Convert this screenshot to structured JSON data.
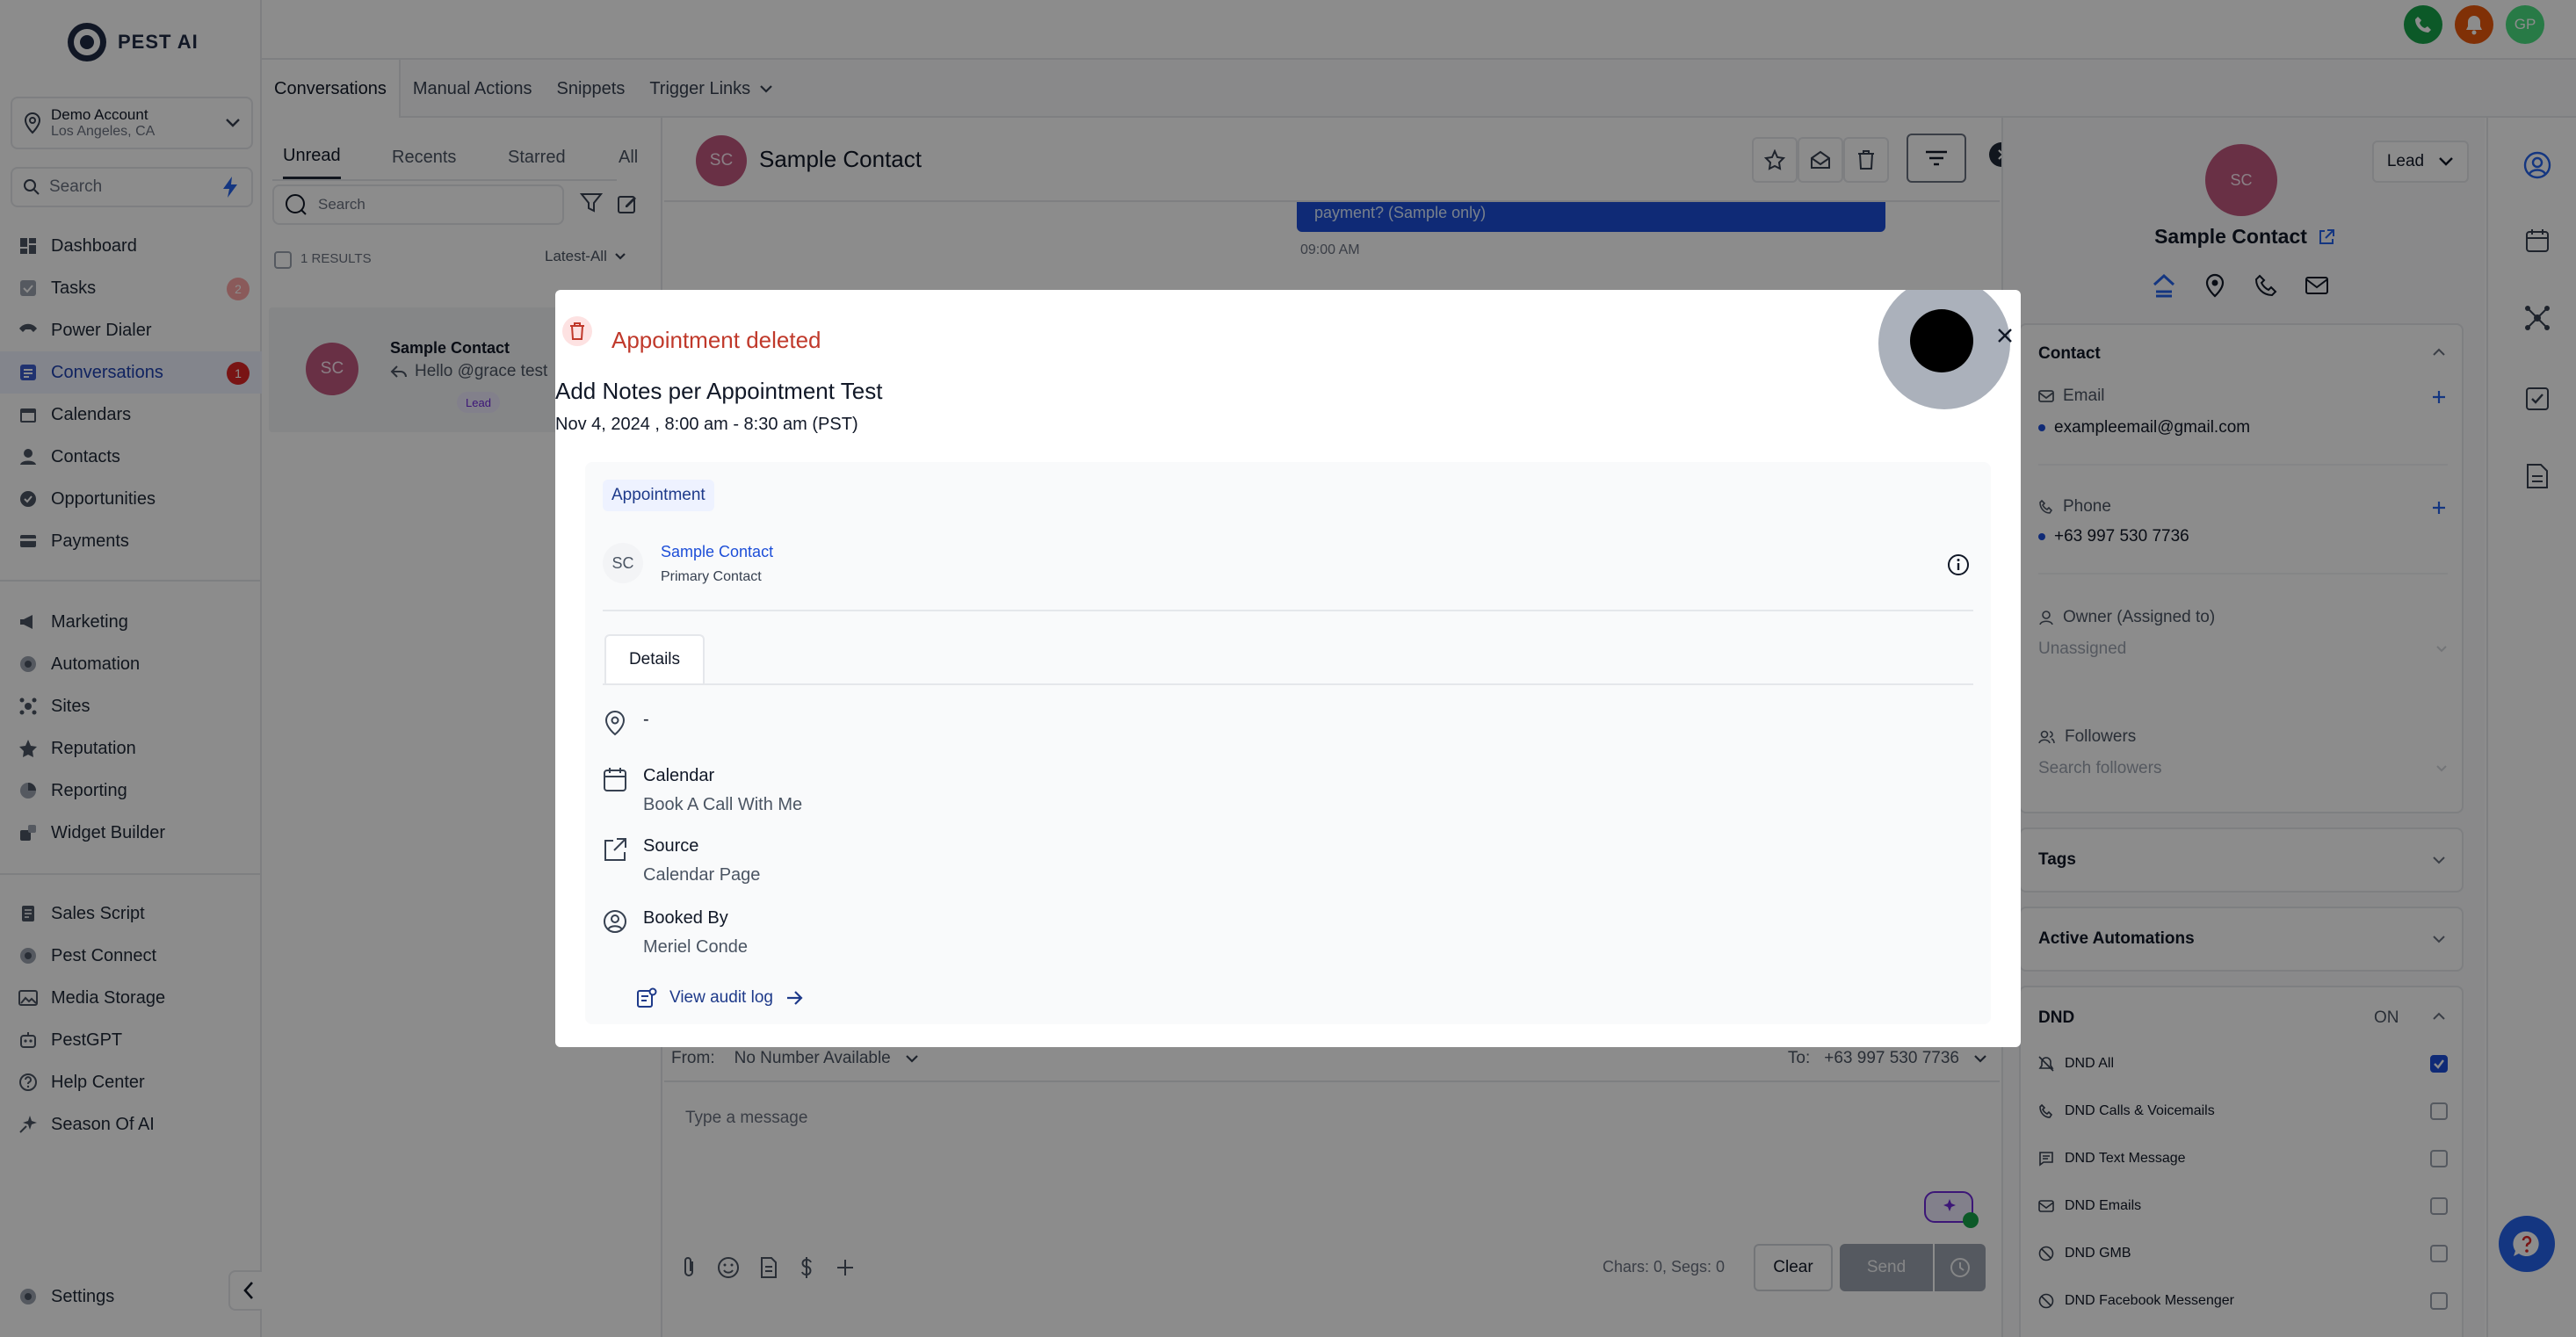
{
  "app": {
    "brand": "PEST AI"
  },
  "account": {
    "name": "Demo Account",
    "location": "Los Angeles, CA"
  },
  "sidebar": {
    "search_placeholder": "Search",
    "group1": [
      {
        "label": "Dashboard",
        "icon": "dashboard-icon"
      },
      {
        "label": "Tasks",
        "icon": "tasks-icon",
        "badge": "2"
      },
      {
        "label": "Power Dialer",
        "icon": "power-dialer-icon"
      },
      {
        "label": "Conversations",
        "icon": "conversations-icon",
        "badge": "1",
        "active": true
      },
      {
        "label": "Calendars",
        "icon": "calendar-icon"
      },
      {
        "label": "Contacts",
        "icon": "contacts-icon"
      },
      {
        "label": "Opportunities",
        "icon": "opportunities-icon"
      },
      {
        "label": "Payments",
        "icon": "payments-icon"
      }
    ],
    "group2": [
      {
        "label": "Marketing",
        "icon": "marketing-icon"
      },
      {
        "label": "Automation",
        "icon": "automation-icon"
      },
      {
        "label": "Sites",
        "icon": "sites-icon"
      },
      {
        "label": "Reputation",
        "icon": "reputation-icon"
      },
      {
        "label": "Reporting",
        "icon": "reporting-icon"
      },
      {
        "label": "Widget Builder",
        "icon": "widget-builder-icon"
      }
    ],
    "group3": [
      {
        "label": "Sales Script",
        "icon": "sales-script-icon"
      },
      {
        "label": "Pest Connect",
        "icon": "pest-connect-icon"
      },
      {
        "label": "Media Storage",
        "icon": "media-storage-icon"
      },
      {
        "label": "PestGPT",
        "icon": "pestgpt-icon"
      },
      {
        "label": "Help Center",
        "icon": "help-center-icon"
      },
      {
        "label": "Season Of AI",
        "icon": "season-of-ai-icon"
      }
    ],
    "settings_label": "Settings"
  },
  "topbar": {
    "user_initials": "GP",
    "colors": {
      "phone": "#16a34a",
      "bell": "#ea580c",
      "user": "#4ade80"
    }
  },
  "tabs": [
    "Conversations",
    "Manual Actions",
    "Snippets",
    "Trigger Links"
  ],
  "conv_list": {
    "subtabs": [
      "Unread",
      "Recents",
      "Starred",
      "All"
    ],
    "search_placeholder": "Search",
    "results_label": "1 RESULTS",
    "sort_label": "Latest-All",
    "item": {
      "initials": "SC",
      "name": "Sample Contact",
      "preview": "Hello @grace test",
      "tag": "Lead"
    }
  },
  "chat": {
    "contact_initials": "SC",
    "contact_name": "Sample Contact",
    "bubble_text": "payment? (Sample only)",
    "bubble_time": "09:00 AM",
    "from_label": "From:",
    "from_value": "No Number Available",
    "to_label": "To:",
    "to_value": "+63 997 530 7736",
    "message_placeholder": "Type a message",
    "chars_label": "Chars: 0, Segs: 0",
    "clear_label": "Clear",
    "send_label": "Send"
  },
  "right_panel": {
    "stage": "Lead",
    "initials": "SC",
    "name": "Sample Contact",
    "contact_section": "Contact",
    "email_label": "Email",
    "email_value": "exampleemail@gmail.com",
    "phone_label": "Phone",
    "phone_value": "+63 997 530 7736",
    "owner_label": "Owner (Assigned to)",
    "owner_value": "Unassigned",
    "followers_label": "Followers",
    "followers_placeholder": "Search followers",
    "tags_label": "Tags",
    "automations_label": "Active Automations",
    "dnd_label": "DND",
    "dnd_state": "ON",
    "dnd_items": [
      {
        "label": "DND All",
        "checked": true,
        "icon": "bell-off-icon"
      },
      {
        "label": "DND Calls & Voicemails",
        "checked": false,
        "icon": "phone-icon"
      },
      {
        "label": "DND Text Message",
        "checked": false,
        "icon": "message-icon"
      },
      {
        "label": "DND Emails",
        "checked": false,
        "icon": "mail-icon"
      },
      {
        "label": "DND GMB",
        "checked": false,
        "icon": "block-icon"
      },
      {
        "label": "DND Facebook Messenger",
        "checked": false,
        "icon": "block-icon"
      }
    ]
  },
  "modal": {
    "status": "Appointment deleted",
    "title": "Add Notes per Appointment Test",
    "datetime": "Nov 4, 2024 , 8:00 am - 8:30 am (PST)",
    "appointment_tag": "Appointment",
    "contact_initials": "SC",
    "contact_name": "Sample Contact",
    "contact_role": "Primary Contact",
    "details_tab": "Details",
    "location_value": "-",
    "calendar_label": "Calendar",
    "calendar_value": "Book A Call With Me",
    "source_label": "Source",
    "source_value": "Calendar Page",
    "booked_by_label": "Booked By",
    "booked_by_value": "Meriel Conde",
    "audit_link": "View audit log"
  },
  "colors": {
    "accent": "#1d4ed8",
    "danger": "#c0392b",
    "avatar": "#c0587e"
  }
}
